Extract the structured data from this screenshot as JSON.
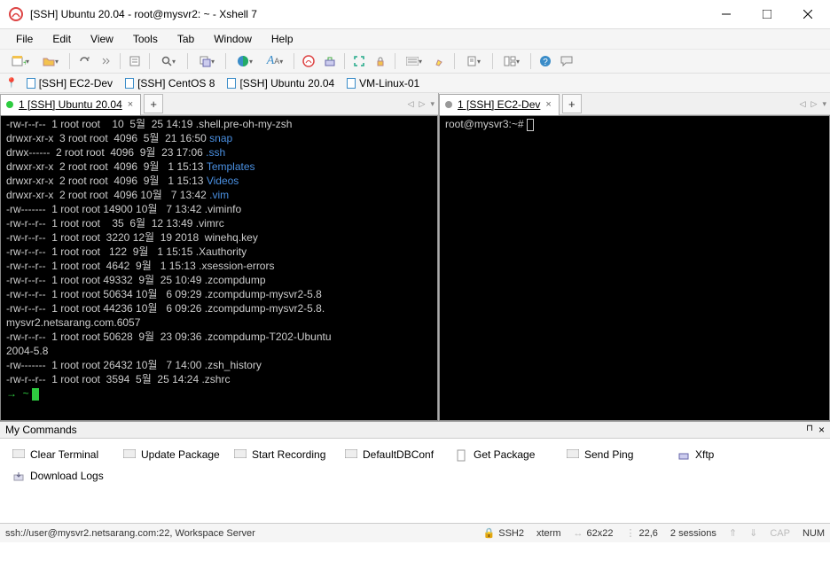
{
  "window": {
    "title": "[SSH] Ubuntu 20.04 - root@mysvr2: ~ - Xshell 7"
  },
  "menu": [
    "File",
    "Edit",
    "View",
    "Tools",
    "Tab",
    "Window",
    "Help"
  ],
  "session_tabs": {
    "items": [
      {
        "label": "[SSH] EC2-Dev"
      },
      {
        "label": "[SSH] CentOS 8"
      },
      {
        "label": "[SSH] Ubuntu 20.04"
      },
      {
        "label": "VM-Linux-01"
      }
    ]
  },
  "panes": {
    "left_tab": "1 [SSH] Ubuntu 20.04",
    "right_tab": "1 [SSH] EC2-Dev",
    "right_prompt": "root@mysvr3:~# "
  },
  "ls": [
    {
      "perm": "-rw-r--r--",
      "n": "1",
      "o": "root",
      "g": "root",
      "sz": "10",
      "m": "5월",
      "d": "25",
      "t": "14:19",
      "name": ".shell.pre-oh-my-zsh",
      "cls": "nor",
      "wrap": true
    },
    {
      "perm": "drwxr-xr-x",
      "n": "3",
      "o": "root",
      "g": "root",
      "sz": "4096",
      "m": "5월",
      "d": "21",
      "t": "16:50",
      "name": "snap",
      "cls": "blue"
    },
    {
      "perm": "drwx------",
      "n": "2",
      "o": "root",
      "g": "root",
      "sz": "4096",
      "m": "9월",
      "d": "23",
      "t": "17:06",
      "name": ".ssh",
      "cls": "blue"
    },
    {
      "perm": "drwxr-xr-x",
      "n": "2",
      "o": "root",
      "g": "root",
      "sz": "4096",
      "m": "9월",
      "d": "1",
      "t": "15:13",
      "name": "Templates",
      "cls": "blue"
    },
    {
      "perm": "drwxr-xr-x",
      "n": "2",
      "o": "root",
      "g": "root",
      "sz": "4096",
      "m": "9월",
      "d": "1",
      "t": "15:13",
      "name": "Videos",
      "cls": "blue"
    },
    {
      "perm": "drwxr-xr-x",
      "n": "2",
      "o": "root",
      "g": "root",
      "sz": "4096",
      "m": "10월",
      "d": "7",
      "t": "13:42",
      "name": ".vim",
      "cls": "blue"
    },
    {
      "perm": "-rw-------",
      "n": "1",
      "o": "root",
      "g": "root",
      "sz": "14900",
      "m": "10월",
      "d": "7",
      "t": "13:42",
      "name": ".viminfo",
      "cls": "nor"
    },
    {
      "perm": "-rw-r--r--",
      "n": "1",
      "o": "root",
      "g": "root",
      "sz": "35",
      "m": "6월",
      "d": "12",
      "t": "13:49",
      "name": ".vimrc",
      "cls": "nor"
    },
    {
      "perm": "-rw-r--r--",
      "n": "1",
      "o": "root",
      "g": "root",
      "sz": "3220",
      "m": "12월",
      "d": "19",
      "t": "2018",
      "name": "winehq.key",
      "cls": "nor"
    },
    {
      "perm": "-rw-r--r--",
      "n": "1",
      "o": "root",
      "g": "root",
      "sz": "122",
      "m": "9월",
      "d": "1",
      "t": "15:15",
      "name": ".Xauthority",
      "cls": "nor"
    },
    {
      "perm": "-rw-r--r--",
      "n": "1",
      "o": "root",
      "g": "root",
      "sz": "4642",
      "m": "9월",
      "d": "1",
      "t": "15:13",
      "name": ".xsession-errors",
      "cls": "nor"
    },
    {
      "perm": "-rw-r--r--",
      "n": "1",
      "o": "root",
      "g": "root",
      "sz": "49332",
      "m": "9월",
      "d": "25",
      "t": "10:49",
      "name": ".zcompdump",
      "cls": "nor"
    },
    {
      "perm": "-rw-r--r--",
      "n": "1",
      "o": "root",
      "g": "root",
      "sz": "50634",
      "m": "10월",
      "d": "6",
      "t": "09:29",
      "name": ".zcompdump-mysvr2-5.8",
      "cls": "nor",
      "wrap": true
    },
    {
      "perm": "-rw-r--r--",
      "n": "1",
      "o": "root",
      "g": "root",
      "sz": "44236",
      "m": "10월",
      "d": "6",
      "t": "09:26",
      "name": ".zcompdump-mysvr2-5.8.mysvr2.netsarang.com.6057",
      "cls": "nor",
      "wrap": true
    },
    {
      "perm": "-rw-r--r--",
      "n": "1",
      "o": "root",
      "g": "root",
      "sz": "50628",
      "m": "9월",
      "d": "23",
      "t": "09:36",
      "name": ".zcompdump-T202-Ubuntu2004-5.8",
      "cls": "nor",
      "wrap": true
    },
    {
      "perm": "-rw-------",
      "n": "1",
      "o": "root",
      "g": "root",
      "sz": "26432",
      "m": "10월",
      "d": "7",
      "t": "14:00",
      "name": ".zsh_history",
      "cls": "nor"
    },
    {
      "perm": "-rw-r--r--",
      "n": "1",
      "o": "root",
      "g": "root",
      "sz": "3594",
      "m": "5월",
      "d": "25",
      "t": "14:24",
      "name": ".zshrc",
      "cls": "nor"
    }
  ],
  "mycommands": {
    "title": "My Commands",
    "items": [
      "Clear Terminal",
      "Update Package",
      "Start Recording",
      "DefaultDBConf",
      "Get Package",
      "Send Ping",
      "Xftp",
      "Download Logs"
    ]
  },
  "status": {
    "left": "ssh://user@mysvr2.netsarang.com:22, Workspace Server",
    "proto": "SSH2",
    "term": "xterm",
    "size": "62x22",
    "pos": "22,6",
    "sessions": "2 sessions",
    "cap": "CAP",
    "num": "NUM"
  },
  "icons": {
    "add": "+",
    "close": "×",
    "dropdown": "▾",
    "left": "◀",
    "right": "▶",
    "updown": "⇳",
    "pin": "📌",
    "lock": "🔒"
  }
}
